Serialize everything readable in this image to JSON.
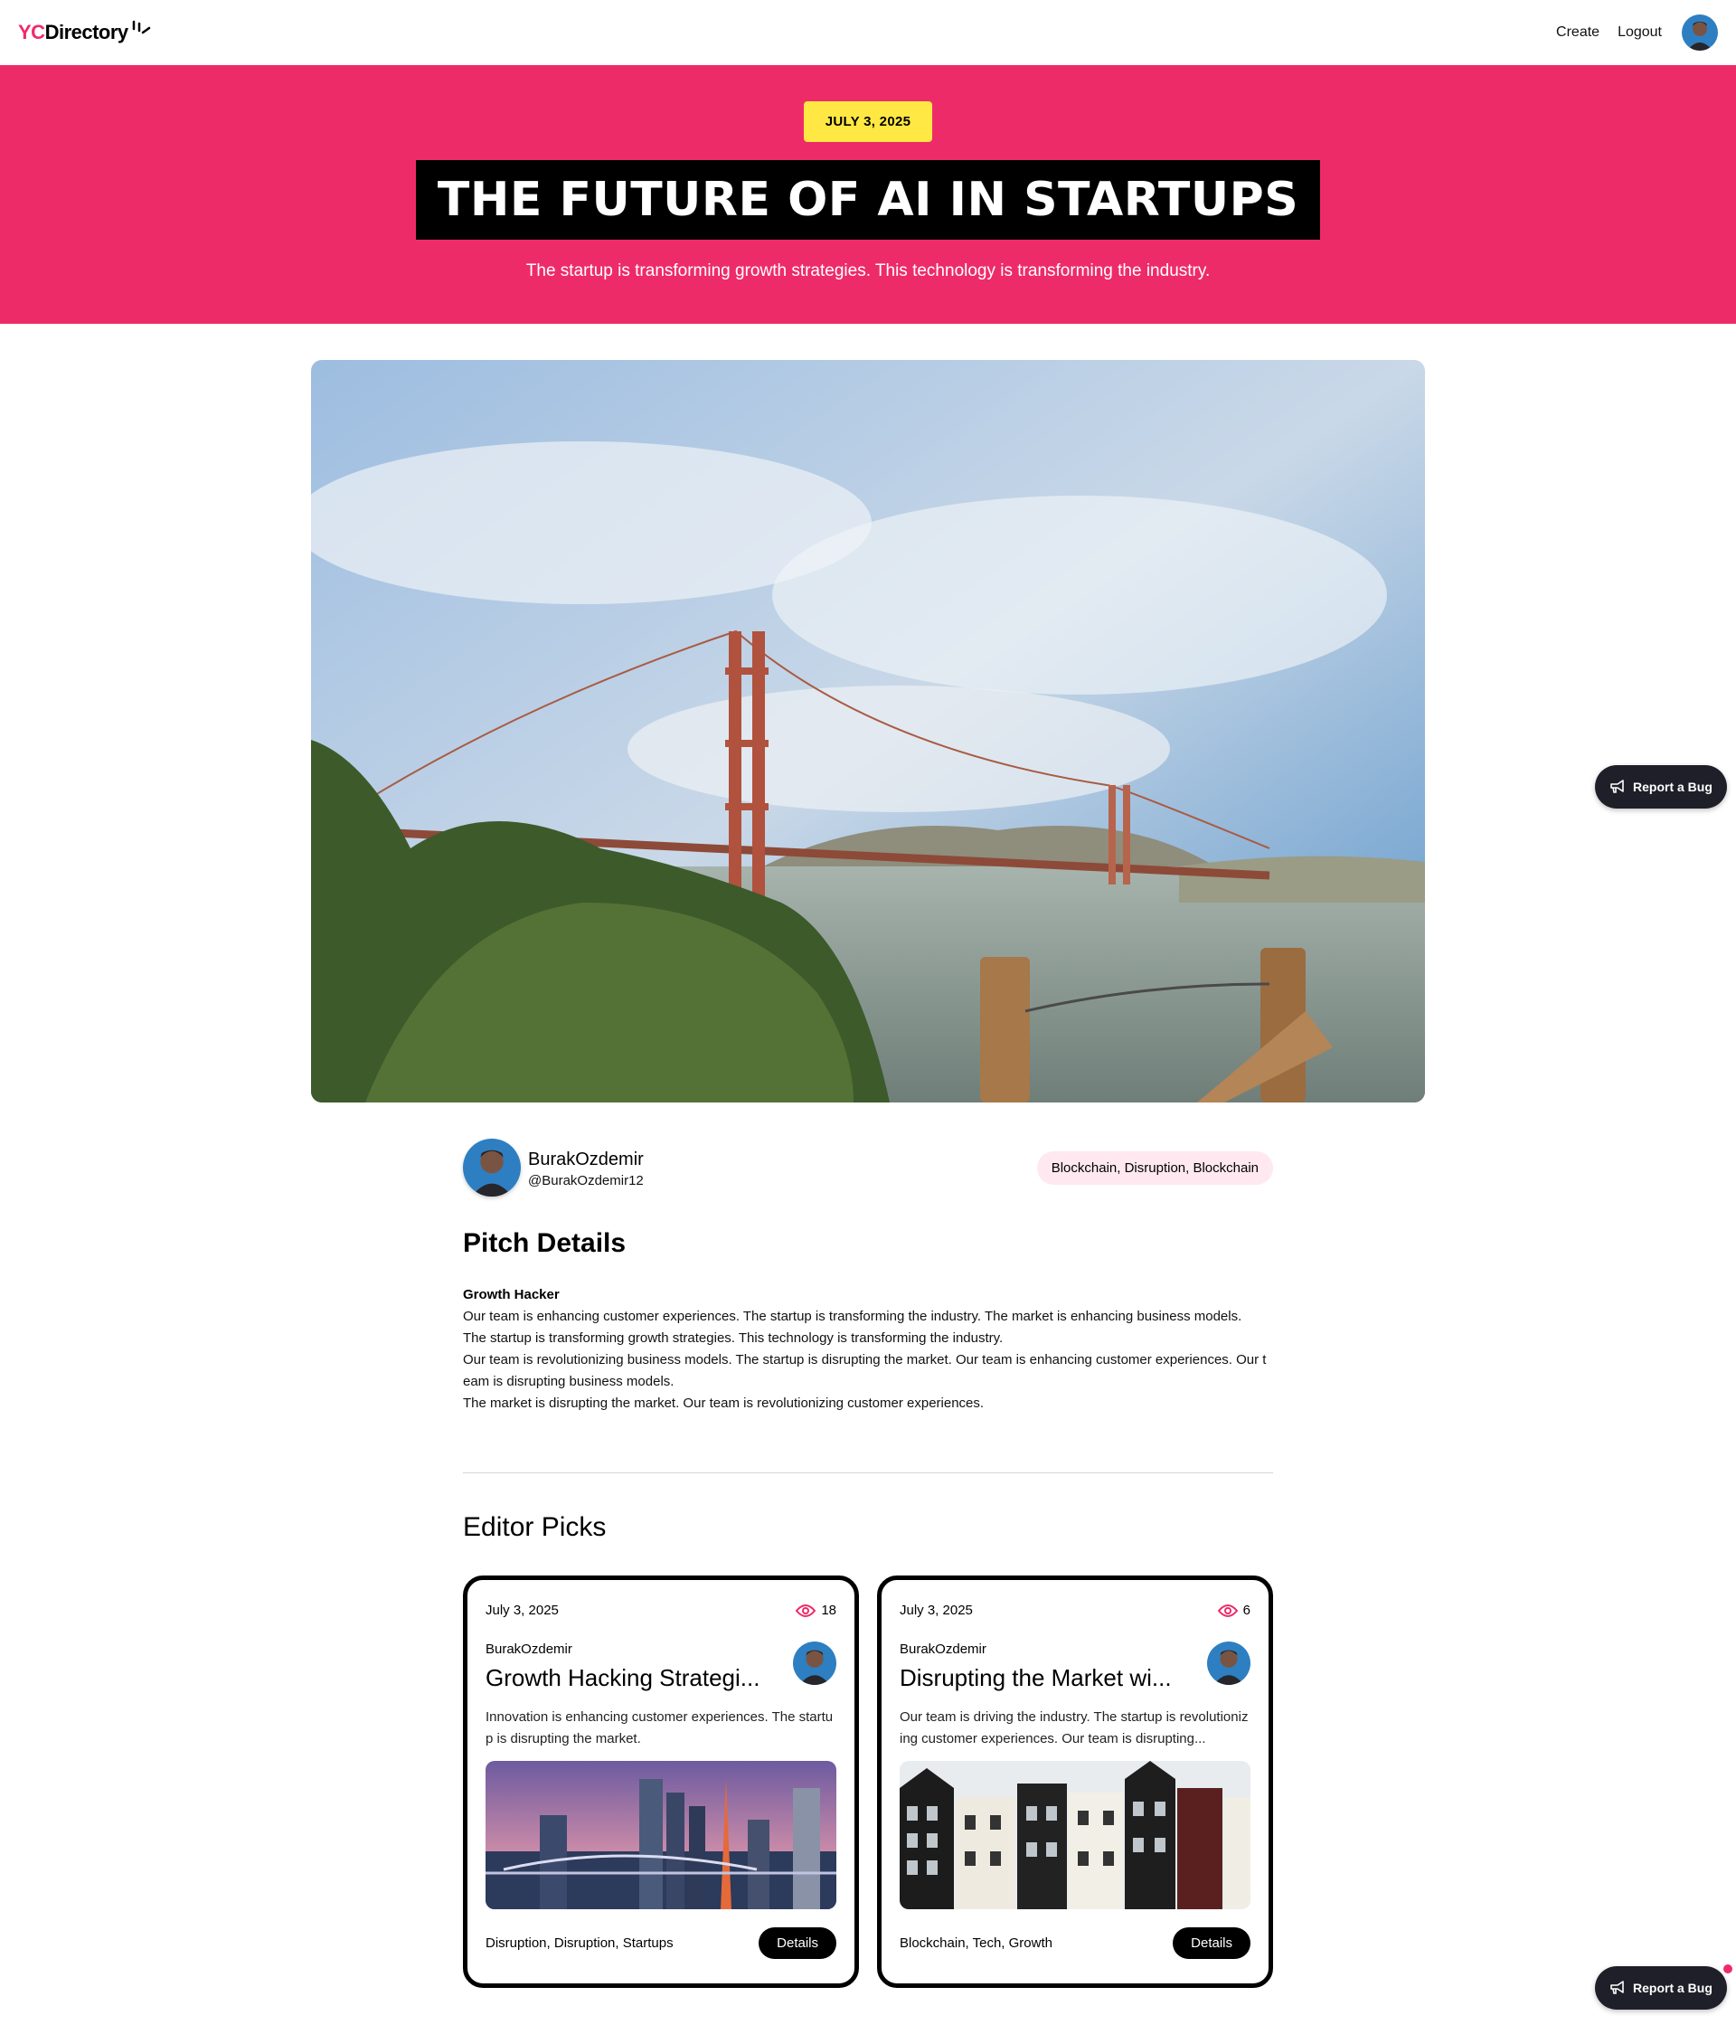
{
  "nav": {
    "logo_prefix": "YC",
    "logo_suffix": "Directory",
    "create": "Create",
    "logout": "Logout"
  },
  "hero": {
    "date": "JULY 3, 2025",
    "title": "THE FUTURE OF AI IN STARTUPS",
    "subtitle": "The startup is transforming growth strategies. This technology is transforming the industry."
  },
  "author": {
    "name": "BurakOzdemir",
    "handle": "@BurakOzdemir12",
    "categories": "Blockchain, Disruption, Blockchain"
  },
  "pitch": {
    "title": "Pitch Details",
    "heading": "Growth Hacker",
    "lines": [
      "Our team is enhancing customer experiences. The startup is transforming the industry. The market is enhancing business models.",
      "The startup is transforming growth strategies. This technology is transforming the industry.",
      "Our team is revolutionizing business models. The startup is disrupting the market. Our team is enhancing customer experiences. Our team is disrupting business models.",
      "The market is disrupting the market. Our team is revolutionizing customer experiences."
    ]
  },
  "editor_picks": {
    "title": "Editor Picks",
    "cards": [
      {
        "date": "July 3, 2025",
        "views": "18",
        "author": "BurakOzdemir",
        "title": "Growth Hacking Strategi...",
        "description": "Innovation is enhancing customer experiences. The startup is disrupting the market.",
        "tags": "Disruption, Disruption, Startups",
        "button": "Details"
      },
      {
        "date": "July 3, 2025",
        "views": "6",
        "author": "BurakOzdemir",
        "title": "Disrupting the Market wi...",
        "description": "Our team is driving the industry. The startup is revolutionizing customer experiences. Our team is disrupting...",
        "tags": "Blockchain, Tech, Growth",
        "button": "Details"
      }
    ]
  },
  "report_bug": "Report a Bug",
  "colors": {
    "primary": "#EE2B69",
    "badge": "#FFE843",
    "pill": "#FFE8F0",
    "dark": "#1f1f29"
  },
  "icons": [
    "spark-icon",
    "eye-icon",
    "megaphone-icon"
  ]
}
